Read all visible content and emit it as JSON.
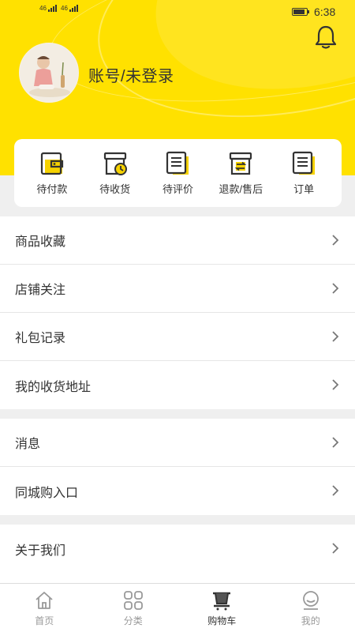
{
  "status_bar": {
    "signal1": "46",
    "signal2": "46",
    "time": "6:38"
  },
  "profile": {
    "username": "账号/未登录"
  },
  "orders": [
    {
      "label": "待付款",
      "icon": "wallet-icon"
    },
    {
      "label": "待收货",
      "icon": "delivery-box-icon"
    },
    {
      "label": "待评价",
      "icon": "review-document-icon"
    },
    {
      "label": "退款/售后",
      "icon": "refund-box-icon"
    },
    {
      "label": "订单",
      "icon": "order-list-icon"
    }
  ],
  "menu_group1": [
    {
      "label": "商品收藏"
    },
    {
      "label": "店铺关注"
    },
    {
      "label": "礼包记录"
    },
    {
      "label": "我的收货地址"
    }
  ],
  "menu_group2": [
    {
      "label": "消息"
    },
    {
      "label": "同城购入口"
    }
  ],
  "menu_group3": [
    {
      "label": "关于我们"
    }
  ],
  "tabs": [
    {
      "label": "首页",
      "icon": "home-icon"
    },
    {
      "label": "分类",
      "icon": "category-icon"
    },
    {
      "label": "购物车",
      "icon": "cart-icon",
      "active": true
    },
    {
      "label": "我的",
      "icon": "profile-icon"
    }
  ],
  "colors": {
    "accent": "#ffe100",
    "icon_yellow": "#f6d200",
    "text": "#333333",
    "muted": "#999999"
  }
}
